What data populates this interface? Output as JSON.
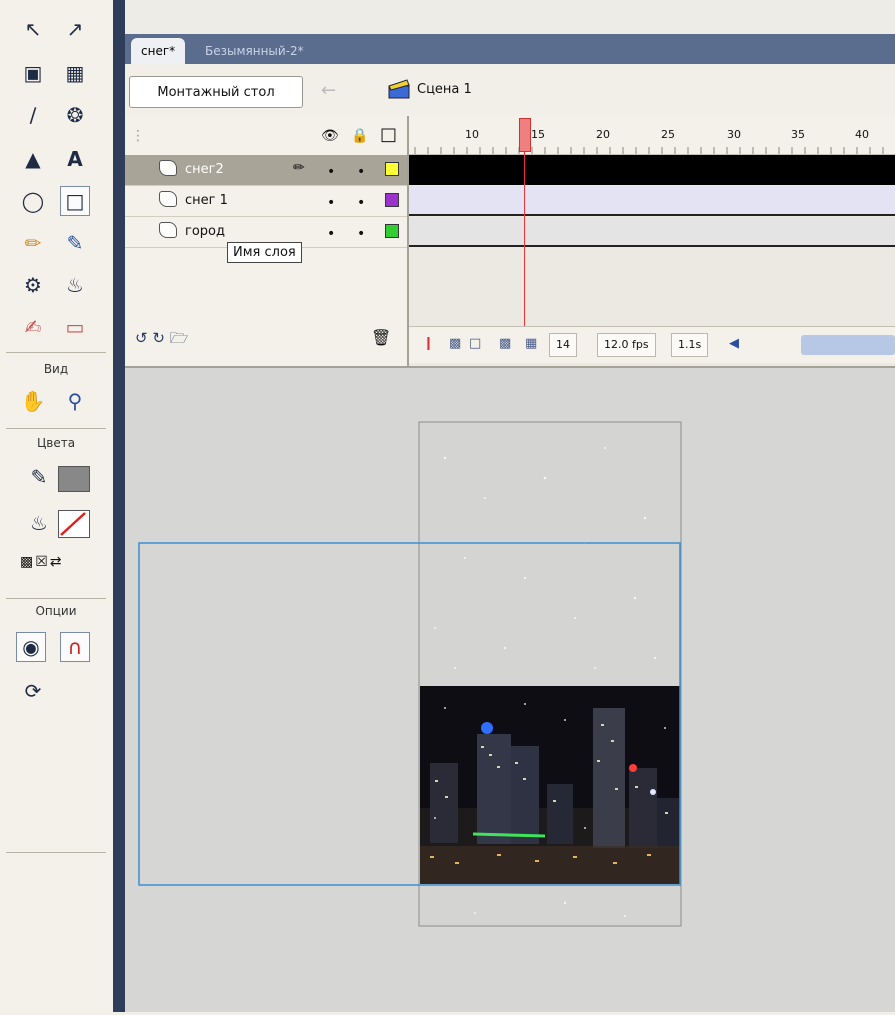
{
  "tools_panel": {
    "sections": [
      {
        "title": "Вид"
      },
      {
        "title": "Цвета"
      },
      {
        "title": "Опции"
      }
    ]
  },
  "tabs": {
    "active": "снег*",
    "inactive": "Безымянный-2*"
  },
  "editbar": {
    "stage_button": "Монтажный стол",
    "scene_label": "Сцена 1"
  },
  "timeline": {
    "layers": [
      {
        "name": "снег2",
        "color": "#ffff33",
        "selected": true
      },
      {
        "name": "снег 1",
        "color": "#9933cc",
        "selected": false
      },
      {
        "name": "город",
        "color": "#33cc33",
        "selected": false
      }
    ],
    "tooltip": "Имя слоя",
    "ruler_labels": [
      "10",
      "15",
      "20",
      "25",
      "30",
      "35",
      "40"
    ],
    "status": {
      "frame": "14",
      "fps": "12.0 fps",
      "time": "1.1s"
    }
  },
  "colors": {
    "tabbar": "#5b6d8f",
    "stage_bg": "#d6d6d4",
    "selection": "#3b8fd6"
  }
}
